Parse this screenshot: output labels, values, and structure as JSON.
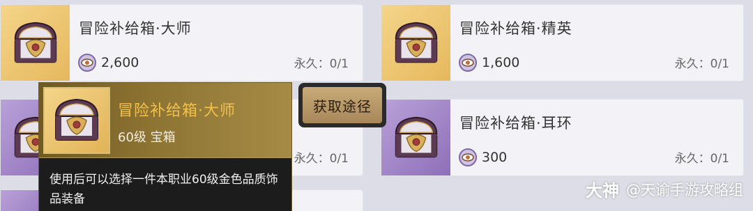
{
  "items": [
    {
      "title": "冒险补给箱·大师",
      "price": "2,600",
      "limit": "永久：0/1",
      "thumb": "gold",
      "icon": "chest-icon"
    },
    {
      "title": "冒险补给箱·精英",
      "price": "1,600",
      "limit": "永久：0/1",
      "thumb": "gold",
      "icon": "chest-icon"
    },
    {
      "title": "",
      "price": "",
      "limit": "永久：0/1",
      "thumb": "purple",
      "icon": "chest-icon"
    },
    {
      "title": "冒险补给箱·耳环",
      "price": "300",
      "limit": "永久：0/1",
      "thumb": "purple",
      "icon": "chest-icon"
    }
  ],
  "currency_icon": "eye-coin-icon",
  "tooltip": {
    "title": "冒险补给箱·大师",
    "subtitle": "60级 宝箱",
    "description": "使用后可以选择一件本职业60级金色品质饰品装备",
    "title_color": "#f2c14b"
  },
  "acquire_button": {
    "label": "获取途径"
  },
  "watermark": {
    "logo": "大神",
    "text": "@天谕手游攻略组"
  },
  "colors": {
    "gold_thumb": "#f4d58a",
    "purple_thumb": "#a98bcf",
    "tooltip_bg": "#1c1c1c",
    "button_bg": "#b89868"
  }
}
